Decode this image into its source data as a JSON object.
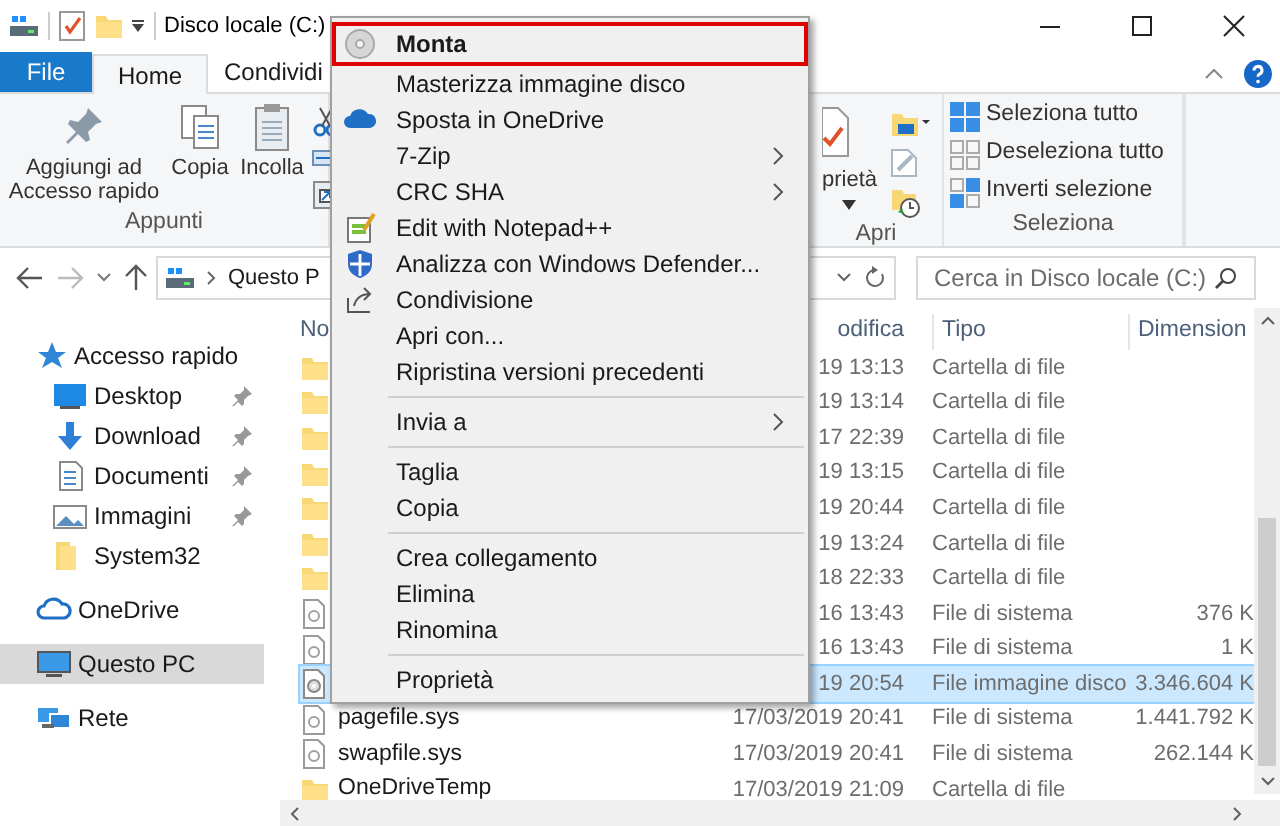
{
  "window": {
    "title": "Disco locale (C:)"
  },
  "ribbon_tabs": [
    {
      "label": "File",
      "kind": "file",
      "selected": false
    },
    {
      "label": "Home",
      "kind": "tab",
      "selected": true
    },
    {
      "label": "Condividi",
      "kind": "tab",
      "selected": false
    }
  ],
  "clipboard_group": {
    "label": "Appunti",
    "buttons": [
      "Aggiungi ad Accesso rapido",
      "Copia",
      "Incolla"
    ]
  },
  "open_group": {
    "label": "Apri",
    "buttons": [
      "prietà"
    ]
  },
  "select_group": {
    "label": "Seleziona",
    "buttons": [
      "Seleziona tutto",
      "Deseleziona tutto",
      "Inverti selezione"
    ]
  },
  "address_bar": {
    "crumbs": [
      "Questo P"
    ]
  },
  "search": {
    "placeholder": "Cerca in Disco locale (C:)"
  },
  "navigation": [
    {
      "label": "Accesso rapido",
      "kind": "quick",
      "selected": false,
      "children": [
        {
          "label": "Desktop",
          "kind": "desktop",
          "pinned": true,
          "selected": false
        },
        {
          "label": "Download",
          "kind": "download",
          "pinned": true,
          "selected": false
        },
        {
          "label": "Documenti",
          "kind": "documents",
          "pinned": true,
          "selected": false
        },
        {
          "label": "Immagini",
          "kind": "pictures",
          "pinned": true,
          "selected": false
        },
        {
          "label": "System32",
          "kind": "folder",
          "pinned": false,
          "selected": false
        }
      ]
    },
    {
      "label": "OneDrive",
      "kind": "onedrive",
      "selected": false
    },
    {
      "label": "Questo PC",
      "kind": "pc",
      "selected": true
    },
    {
      "label": "Rete",
      "kind": "network",
      "selected": false
    }
  ],
  "file_list": {
    "columns": [
      "No",
      "odifica",
      "Tipo",
      "Dimension"
    ],
    "rows": [
      {
        "kind": "folder",
        "date": "19 13:13",
        "type": "Cartella di file",
        "selected": false
      },
      {
        "kind": "folder",
        "date": "19 13:14",
        "type": "Cartella di file",
        "selected": false
      },
      {
        "kind": "folder",
        "date": "17 22:39",
        "type": "Cartella di file",
        "selected": false
      },
      {
        "kind": "folder",
        "date": "19 13:15",
        "type": "Cartella di file",
        "selected": false
      },
      {
        "kind": "folder",
        "date": "19 20:44",
        "type": "Cartella di file",
        "selected": false
      },
      {
        "kind": "folder",
        "date": "19 13:24",
        "type": "Cartella di file",
        "selected": false
      },
      {
        "kind": "folder",
        "date": "18 22:33",
        "type": "Cartella di file",
        "selected": false
      },
      {
        "kind": "system",
        "date": "16 13:43",
        "type": "File di sistema",
        "size": "376 K",
        "selected": false
      },
      {
        "kind": "system",
        "date": "16 13:43",
        "type": "File di sistema",
        "size": "1 K",
        "selected": false
      },
      {
        "kind": "disc",
        "date": "19 20:54",
        "type": "File immagine disco",
        "size": "3.346.604 K",
        "selected": true
      },
      {
        "kind": "system",
        "name": "pagefile.sys",
        "date": "17/03/2019 20:41",
        "type": "File di sistema",
        "size": "1.441.792 K",
        "selected": false
      },
      {
        "kind": "system",
        "name": "swapfile.sys",
        "date": "17/03/2019 20:41",
        "type": "File di sistema",
        "size": "262.144 K",
        "selected": false
      },
      {
        "kind": "folder",
        "name": "OneDriveTemp",
        "date": "17/03/2019 21:09",
        "type": "Cartella di file",
        "selected": false
      }
    ]
  },
  "context_menu": [
    {
      "kind": "item",
      "label": "Monta",
      "default": true,
      "highlighted": true,
      "submenu": false
    },
    {
      "kind": "item",
      "label": "Masterizza immagine disco",
      "default": false,
      "highlighted": false,
      "submenu": false
    },
    {
      "kind": "item",
      "label": "Sposta in OneDrive",
      "default": false,
      "highlighted": false,
      "submenu": false
    },
    {
      "kind": "item",
      "label": "7-Zip",
      "default": false,
      "highlighted": false,
      "submenu": true
    },
    {
      "kind": "item",
      "label": "CRC SHA",
      "default": false,
      "highlighted": false,
      "submenu": true
    },
    {
      "kind": "item",
      "label": "Edit with Notepad++",
      "default": false,
      "highlighted": false,
      "submenu": false
    },
    {
      "kind": "item",
      "label": "Analizza con Windows Defender...",
      "default": false,
      "highlighted": false,
      "submenu": false
    },
    {
      "kind": "item",
      "label": "Condivisione",
      "default": false,
      "highlighted": false,
      "submenu": false
    },
    {
      "kind": "item",
      "label": "Apri con...",
      "default": false,
      "highlighted": false,
      "submenu": false
    },
    {
      "kind": "item",
      "label": "Ripristina versioni precedenti",
      "default": false,
      "highlighted": false,
      "submenu": false
    },
    {
      "kind": "separator"
    },
    {
      "kind": "item",
      "label": "Invia a",
      "default": false,
      "highlighted": false,
      "submenu": true
    },
    {
      "kind": "separator"
    },
    {
      "kind": "item",
      "label": "Taglia",
      "default": false,
      "highlighted": false,
      "submenu": false
    },
    {
      "kind": "item",
      "label": "Copia",
      "default": false,
      "highlighted": false,
      "submenu": false
    },
    {
      "kind": "separator"
    },
    {
      "kind": "item",
      "label": "Crea collegamento",
      "default": false,
      "highlighted": false,
      "submenu": false
    },
    {
      "kind": "item",
      "label": "Elimina",
      "default": false,
      "highlighted": false,
      "submenu": false
    },
    {
      "kind": "item",
      "label": "Rinomina",
      "default": false,
      "highlighted": false,
      "submenu": false
    },
    {
      "kind": "separator"
    },
    {
      "kind": "item",
      "label": "Proprietà",
      "default": false,
      "highlighted": false,
      "submenu": false
    }
  ]
}
